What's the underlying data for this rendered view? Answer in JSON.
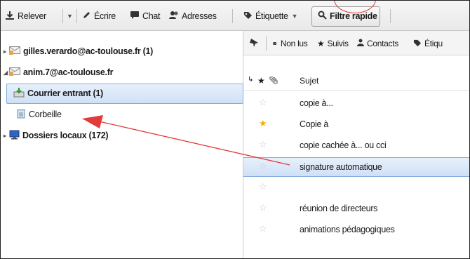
{
  "toolbar": {
    "get_mail": "Relever",
    "write": "Écrire",
    "chat": "Chat",
    "address_book": "Adresses",
    "tag": "Étiquette",
    "quick_filter": "Filtre rapide"
  },
  "folders": {
    "account1": "gilles.verardo@ac-toulouse.fr (1)",
    "account2": "anim.7@ac-toulouse.fr",
    "inbox": "Courrier entrant (1)",
    "trash": "Corbeille",
    "local": "Dossiers locaux (172)"
  },
  "quickfilter": {
    "unread": "Non lus",
    "starred": "Suivis",
    "contacts": "Contacts",
    "tags": "Étiqu"
  },
  "columns": {
    "subject": "Sujet"
  },
  "messages": [
    {
      "subject": "copie à...",
      "starred": false
    },
    {
      "subject": "Copie à",
      "starred": true
    },
    {
      "subject": "copie cachée à... ou cci",
      "starred": false
    },
    {
      "subject": "signature automatique",
      "starred": false,
      "selected": true
    },
    {
      "subject": "",
      "starred": false
    },
    {
      "subject": "réunion de directeurs",
      "starred": false
    },
    {
      "subject": "animations pédagogiques",
      "starred": false
    }
  ],
  "colors": {
    "selection": "#cfe0f6",
    "annotation": "#e23b3b",
    "star_on": "#f0b400"
  }
}
